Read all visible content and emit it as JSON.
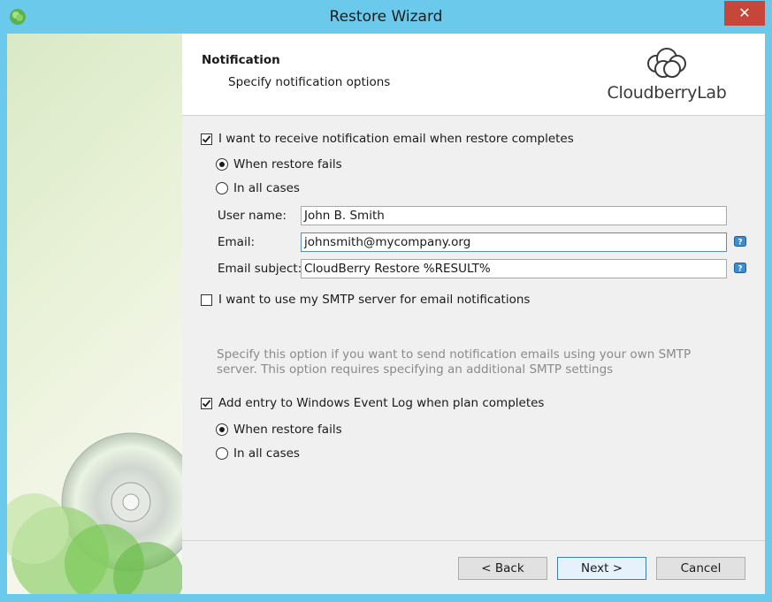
{
  "window": {
    "title": "Restore Wizard",
    "close_symbol": "✕"
  },
  "header": {
    "title": "Notification",
    "subtitle": "Specify notification options",
    "logo_text": "CloudberryLab"
  },
  "notify_email": {
    "label": "I want to receive notification email when restore completes",
    "checked": true,
    "options": [
      {
        "label": "When restore fails",
        "selected": true
      },
      {
        "label": "In all cases",
        "selected": false
      }
    ]
  },
  "fields": {
    "user_name": {
      "label": "User name:",
      "value": "John B. Smith"
    },
    "email": {
      "label": "Email:",
      "value": "johnsmith@mycompany.org"
    },
    "email_subject": {
      "label": "Email subject:",
      "value": "CloudBerry Restore %RESULT%"
    }
  },
  "smtp": {
    "label": "I want to use my SMTP server for email notifications",
    "checked": false,
    "hint": "Specify this option if you want to send notification emails using your own SMTP server. This option requires specifying an additional SMTP settings"
  },
  "event_log": {
    "label": "Add entry to Windows Event Log when plan completes",
    "checked": true,
    "options": [
      {
        "label": "When restore fails",
        "selected": true
      },
      {
        "label": "In all cases",
        "selected": false
      }
    ]
  },
  "buttons": {
    "back": "< Back",
    "next": "Next >",
    "cancel": "Cancel"
  },
  "colors": {
    "title_bar": "#6bcaeb",
    "close_button": "#c7463a",
    "default_button_border": "#3c7fb1"
  }
}
